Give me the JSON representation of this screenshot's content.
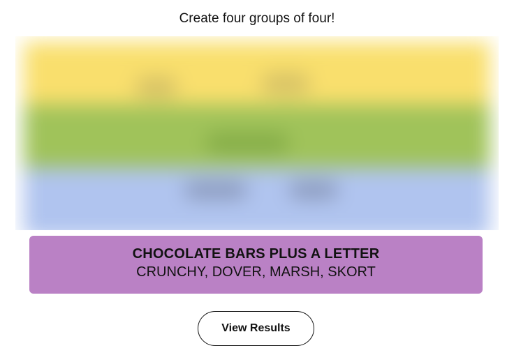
{
  "instructions": "Create four groups of four!",
  "board": {
    "row_colors": [
      "#f9df6d",
      "#a0c35a",
      "#b0c4ef"
    ],
    "blurred": true
  },
  "solved_group": {
    "title": "CHOCOLATE BARS PLUS A LETTER",
    "members": "CRUNCHY, DOVER, MARSH, SKORT",
    "color": "#ba81c5"
  },
  "view_results_label": "View Results"
}
